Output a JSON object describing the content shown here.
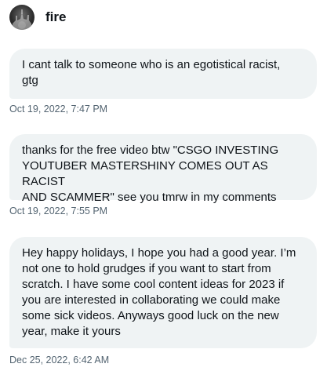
{
  "header": {
    "name": "fire",
    "avatar_icon": "avatar-icon"
  },
  "messages": [
    {
      "text": "I cant talk to someone who is an egotistical racist,\ngtg",
      "timestamp": "Oct 19, 2022, 7:47 PM"
    },
    {
      "text": "thanks for the free video btw \"CSGO INVESTING\nYOUTUBER MASTERSHINY COMES OUT AS RACIST\nAND SCAMMER\" see you tmrw in my comments",
      "timestamp": "Oct 19, 2022, 7:55 PM"
    },
    {
      "text": "Hey happy holidays, I hope you had a good year. I’m\nnot one to hold grudges if you want to start from\nscratch. I have some cool content ideas for 2023 if\nyou are interested in collaborating we could make\nsome sick videos. Anyways good luck on the new\nyear, make it yours",
      "timestamp": "Dec 25, 2022, 6:42 AM"
    }
  ],
  "colors": {
    "bubble_bg": "#eff3f4",
    "text": "#0f1419",
    "timestamp": "#536471"
  }
}
